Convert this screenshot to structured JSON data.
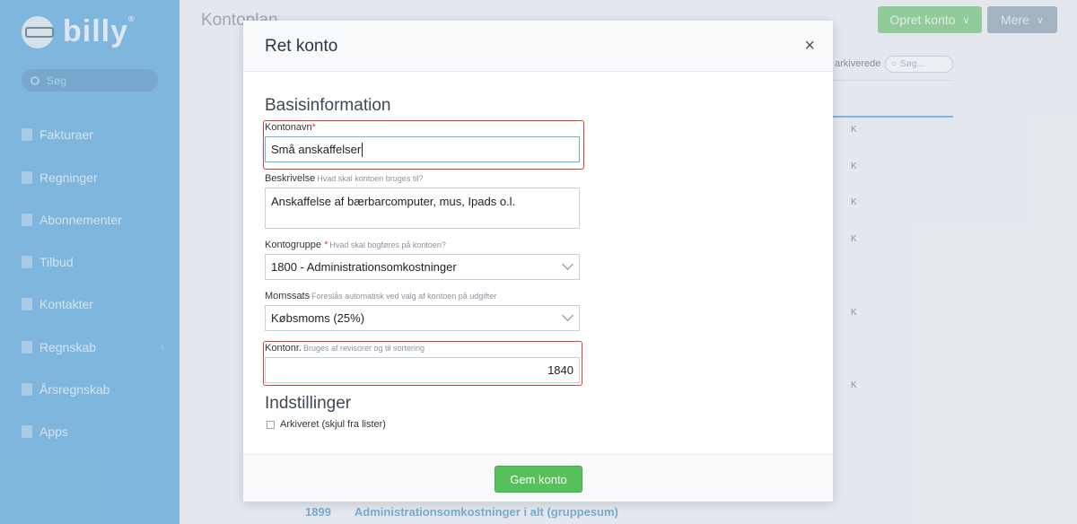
{
  "app": {
    "name": "billy",
    "reg_mark": "®"
  },
  "sidebar": {
    "search_placeholder": "Søg",
    "items": [
      {
        "label": "Fakturaer",
        "icon": "invoice-icon"
      },
      {
        "label": "Regninger",
        "icon": "bill-icon"
      },
      {
        "label": "Abonnementer",
        "icon": "subscription-icon"
      },
      {
        "label": "Tilbud",
        "icon": "star-icon"
      },
      {
        "label": "Kontakter",
        "icon": "contact-icon"
      },
      {
        "label": "Regnskab",
        "icon": "ledger-icon"
      },
      {
        "label": "Årsregnskab",
        "icon": "annual-report-icon"
      },
      {
        "label": "Apps",
        "icon": "apps-icon"
      }
    ]
  },
  "page": {
    "title": "Kontoplan",
    "create_button": "Opret konto",
    "more_button": "Mere",
    "archived_label": "arkiverede",
    "search_placeholder": "Søg...",
    "column_letter": "K",
    "footer_row": {
      "number": "1899",
      "name": "Administrationsomkostninger i alt (gruppesum)"
    }
  },
  "modal": {
    "title": "Ret konto",
    "close": "×",
    "basic_heading": "Basisinformation",
    "name_label": "Kontonavn",
    "required_mark": "*",
    "name_value": "Små anskaffelser",
    "description_label": "Beskrivelse",
    "description_hint": "Hvad skal kontoen bruges til?",
    "description_value": "Anskaffelse af bærbarcomputer, mus, Ipads o.l.",
    "group_label": "Kontogruppe",
    "group_hint": "Hvad skal bogføres på kontoen?",
    "group_value": "1800 - Administrationsomkostninger",
    "vat_label": "Momssats",
    "vat_hint": "Foreslås automatisk ved valg af kontoen på udgifter",
    "vat_value": "Købsmoms (25%)",
    "number_label": "Kontonr.",
    "number_hint": "Bruges af revisorer og til sortering",
    "number_value": "1840",
    "settings_heading": "Indstillinger",
    "archived_checkbox": "Arkiveret (skjul fra lister)",
    "save_button": "Gem konto"
  }
}
